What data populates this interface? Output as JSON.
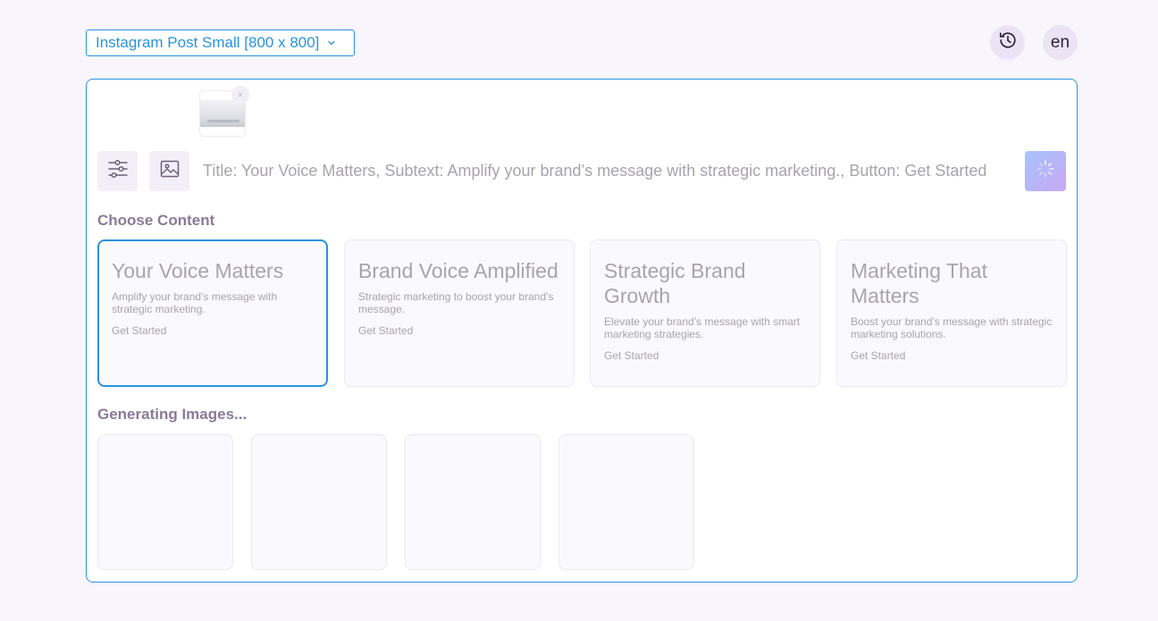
{
  "size_selector": {
    "value": "Instagram Post Small [800 x 800]",
    "icon": "chevron-down-icon"
  },
  "header": {
    "history_icon": "history-icon",
    "language": "en"
  },
  "upload": {
    "remove_label": "×"
  },
  "prompt": {
    "placeholder": "Title: Your Voice Matters, Subtext: Amplify your brand’s message with strategic marketing., Button: Get Started"
  },
  "choose_content": {
    "heading": "Choose Content",
    "cards": [
      {
        "title": "Your Voice Matters",
        "subtext": "Amplify your brand’s message with strategic marketing.",
        "button": "Get Started",
        "selected": true
      },
      {
        "title": "Brand Voice Amplified",
        "subtext": "Strategic marketing to boost your brand’s message.",
        "button": "Get Started",
        "selected": false
      },
      {
        "title": "Strategic Brand Growth",
        "subtext": "Elevate your brand’s message with smart marketing strategies.",
        "button": "Get Started",
        "selected": false
      },
      {
        "title": "Marketing That Matters",
        "subtext": "Boost your brand’s message with strategic marketing solutions.",
        "button": "Get Started",
        "selected": false
      }
    ]
  },
  "generating": {
    "heading": "Generating Images..."
  },
  "colors": {
    "accent": "#2a93de",
    "heading": "#8a7a98",
    "muted_text": "#a8a4ad",
    "generate_gradient_start": "#a6c4fb",
    "generate_gradient_end": "#c9a7f6"
  }
}
